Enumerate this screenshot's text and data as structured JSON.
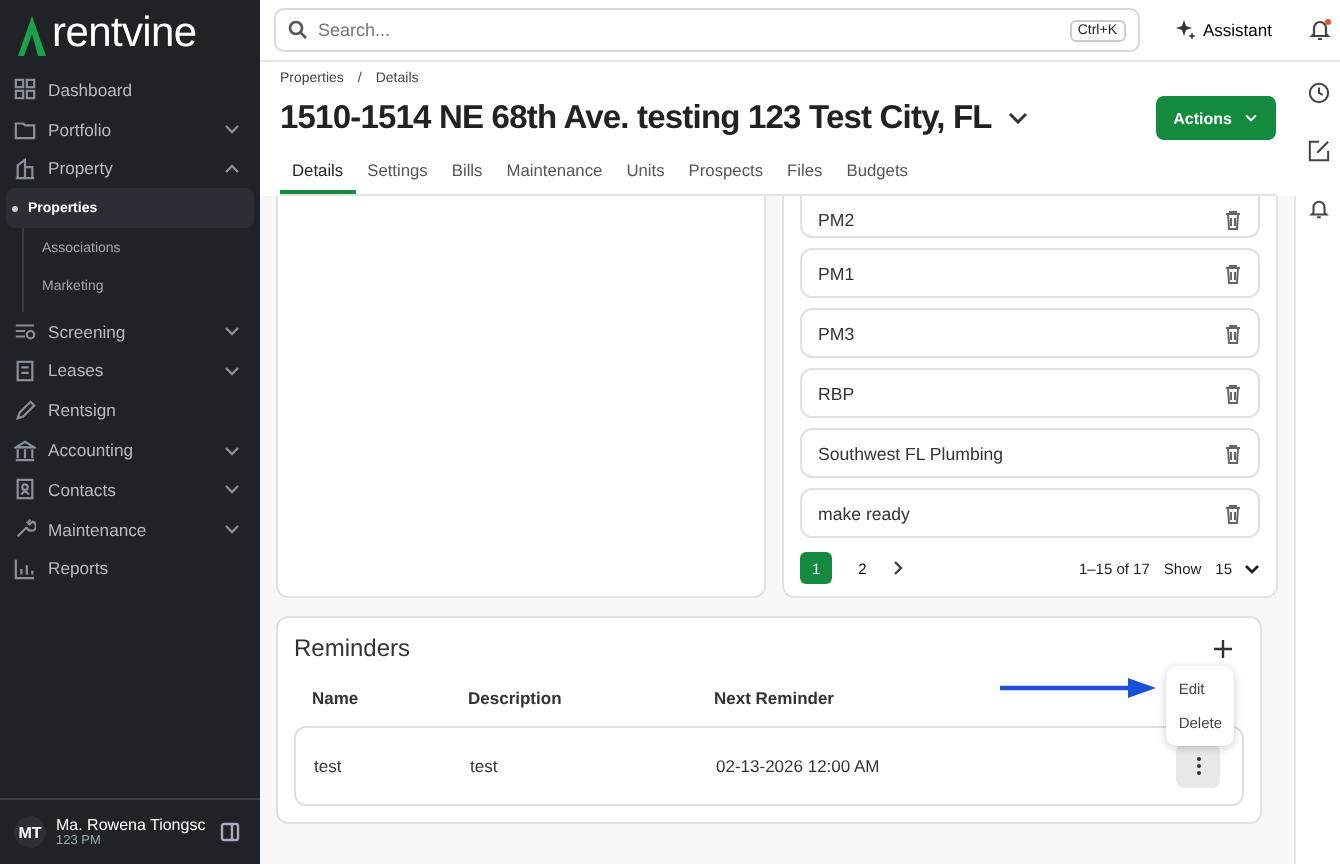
{
  "logo": "rentvine",
  "sidebar": {
    "items": [
      {
        "label": "Dashboard",
        "kind": "link"
      },
      {
        "label": "Portfolio",
        "kind": "group",
        "expanded": false
      },
      {
        "label": "Property",
        "kind": "group",
        "expanded": true,
        "children": [
          {
            "label": "Properties",
            "selected": true
          },
          {
            "label": "Associations",
            "selected": false
          },
          {
            "label": "Marketing",
            "selected": false
          }
        ]
      },
      {
        "label": "Screening",
        "kind": "group",
        "expanded": false
      },
      {
        "label": "Leases",
        "kind": "group",
        "expanded": false
      },
      {
        "label": "Rentsign",
        "kind": "link"
      },
      {
        "label": "Accounting",
        "kind": "group",
        "expanded": false
      },
      {
        "label": "Contacts",
        "kind": "group",
        "expanded": false
      },
      {
        "label": "Maintenance",
        "kind": "group",
        "expanded": false
      },
      {
        "label": "Reports",
        "kind": "link"
      }
    ],
    "user": {
      "initials": "MT",
      "name": "Ma. Rowena Tiongsc",
      "subtitle": "123 PM"
    }
  },
  "topbar": {
    "search_placeholder": "Search...",
    "shortcut": "Ctrl+K",
    "assistant": "Assistant",
    "has_notification": true
  },
  "breadcrumb": {
    "separator": "/",
    "items": [
      "Properties",
      "Details"
    ]
  },
  "title": "1510-1514 NE 68th Ave. testing 123 Test City, FL",
  "actions": "Actions",
  "tabs": [
    {
      "label": "Details",
      "selected": true
    },
    {
      "label": "Settings",
      "selected": false
    },
    {
      "label": "Bills",
      "selected": false
    },
    {
      "label": "Maintenance",
      "selected": false
    },
    {
      "label": "Units",
      "selected": false
    },
    {
      "label": "Prospects",
      "selected": false
    },
    {
      "label": "Files",
      "selected": false
    },
    {
      "label": "Budgets",
      "selected": false
    }
  ],
  "vendors": {
    "items": [
      "PM2",
      "PM1",
      "PM3",
      "RBP",
      "Southwest FL Plumbing",
      "make ready"
    ],
    "pagination": {
      "pages": [
        {
          "label": "1",
          "selected": true
        },
        {
          "label": "2",
          "selected": false
        }
      ],
      "range": "1–15 of 17",
      "show_label": "Show",
      "show_value": "15"
    }
  },
  "reminders": {
    "title": "Reminders",
    "columns": [
      "Name",
      "Description",
      "Next Reminder"
    ],
    "rows": [
      {
        "name": "test",
        "description": "test",
        "next_reminder": "02-13-2026 12:00 AM"
      }
    ],
    "menu": [
      "Edit",
      "Delete"
    ]
  }
}
